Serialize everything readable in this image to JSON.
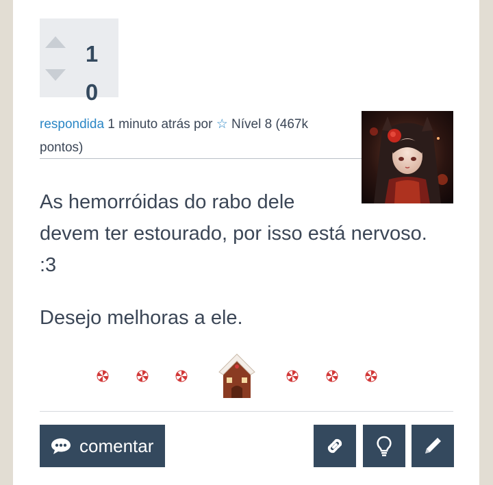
{
  "vote": {
    "upvotes": "1",
    "downvotes": "0"
  },
  "answer_meta": {
    "answered_link": "respondida",
    "time_text": " 1 minuto atrás por ",
    "star": "☆",
    "level_text": " Nível 8 (467k pontos)"
  },
  "answer_body": {
    "line1": "As hemorróidas do rabo dele",
    "line2": "devem ter estourado, por isso está nervoso.",
    "line3": ":3",
    "line4": "Desejo melhoras a ele."
  },
  "actions": {
    "comment_label": "comentar"
  },
  "icons": {
    "comment": "speech-bubble-icon",
    "link": "link-icon",
    "idea": "lightbulb-icon",
    "edit": "pencil-icon",
    "vote_up": "triangle-up-icon",
    "vote_down": "triangle-down-icon"
  },
  "colors": {
    "button_bg": "#34495e",
    "link": "#2a86c5",
    "text": "#3b4656",
    "page_bg": "#e2ddd3"
  }
}
